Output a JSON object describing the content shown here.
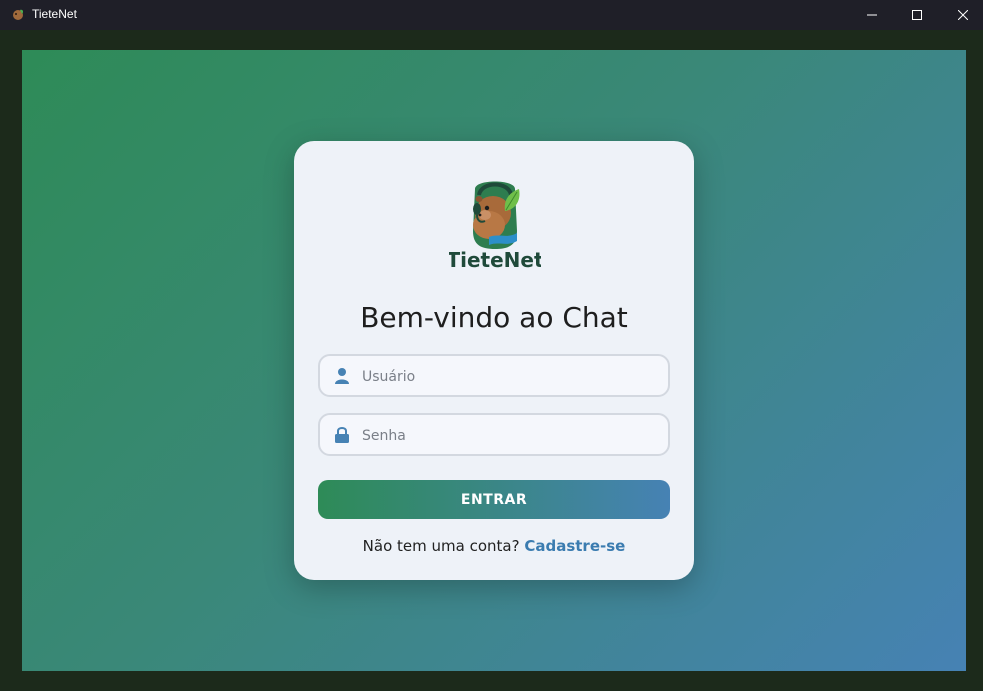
{
  "window": {
    "title": "TieteNet",
    "controls": [
      "minimize-icon",
      "maximize-icon",
      "close-icon"
    ]
  },
  "login": {
    "logo_text": "TieteNet",
    "heading": "Bem-vindo ao Chat",
    "username": {
      "placeholder": "Usuário",
      "value": "",
      "icon": "user-icon"
    },
    "password": {
      "placeholder": "Senha",
      "value": "",
      "icon": "lock-icon"
    },
    "submit_label": "ENTRAR",
    "signup_prompt": "Não tem uma conta?",
    "signup_link": "Cadastre-se"
  },
  "colors": {
    "gradient_start": "#2e8b57",
    "gradient_end": "#4682b4",
    "card_bg": "#eef2f8",
    "link": "#3b7cb0"
  }
}
